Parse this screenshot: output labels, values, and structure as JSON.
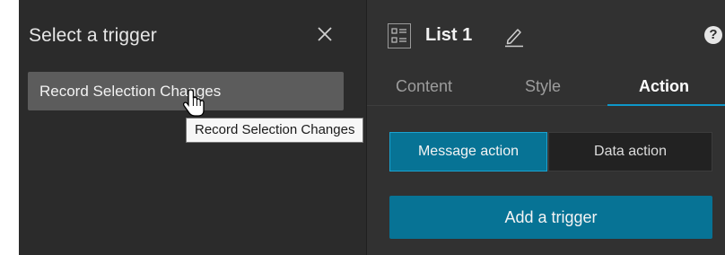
{
  "trigger_panel": {
    "title": "Select a trigger",
    "close_icon": "close-icon",
    "items": [
      {
        "label": "Record Selection Changes",
        "state": "hovered"
      }
    ],
    "tooltip": "Record Selection Changes",
    "cursor": "hand-pointer"
  },
  "widget_panel": {
    "icon": "list-icon",
    "title": "List 1",
    "edit_icon": "pencil-icon",
    "help_icon": "?",
    "tabs": [
      {
        "label": "Content",
        "active": false
      },
      {
        "label": "Style",
        "active": false
      },
      {
        "label": "Action",
        "active": true
      }
    ],
    "action_types": [
      {
        "label": "Message action",
        "selected": true
      },
      {
        "label": "Data action",
        "selected": false
      }
    ],
    "add_trigger_label": "Add a trigger"
  },
  "colors": {
    "panel_bg": "#2b2b2b",
    "accent": "#077395",
    "active_tab_underline": "#0e97c9",
    "hover_item": "#5c5c5c"
  }
}
